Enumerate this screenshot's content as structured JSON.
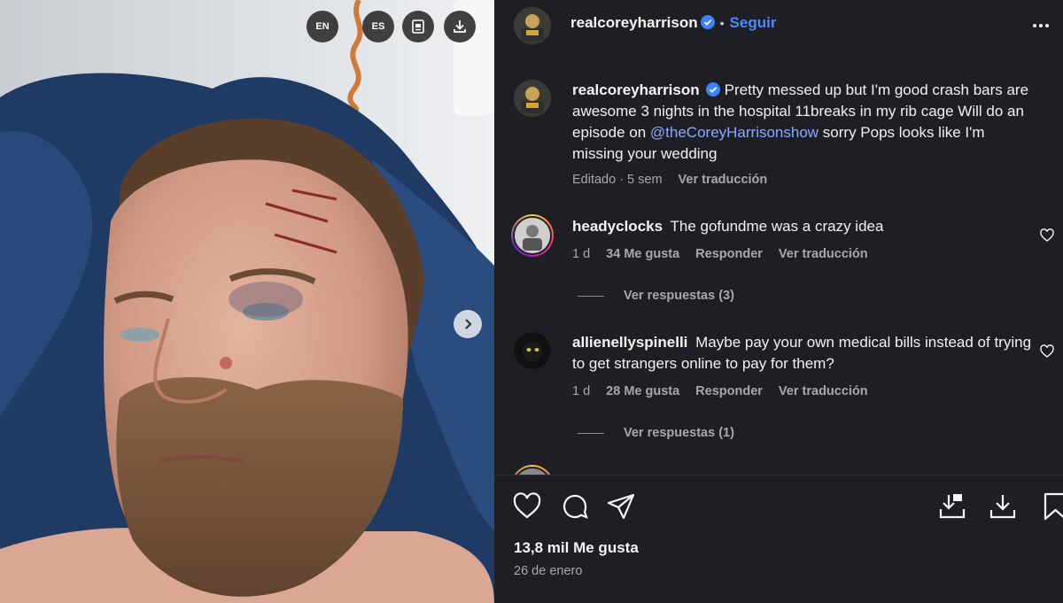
{
  "media": {
    "buttons": [
      {
        "label": "EN",
        "icon": null
      },
      {
        "label": "ES",
        "icon": null
      },
      {
        "label": "",
        "icon": "translate-doc-icon"
      },
      {
        "label": "",
        "icon": "download-icon"
      }
    ],
    "next_icon": "chevron-right-icon"
  },
  "header": {
    "username": "realcoreyharrison",
    "separator": "•",
    "follow_label": "Seguir"
  },
  "caption": {
    "username": "realcoreyharrison",
    "text_before_mention": "Pretty messed up but I'm good crash bars are awesome 3 nights in the hospital 11breaks in my rib cage Will do an episode on ",
    "mention": "@theCoreyHarrisonshow",
    "text_after_mention": " sorry Pops looks like I'm missing your wedding",
    "edited": "Editado",
    "time": "5 sem",
    "translate": "Ver traducción"
  },
  "comments": [
    {
      "username": "headyclocks",
      "text": "The gofundme was a crazy idea",
      "time": "1 d",
      "likes": "34 Me gusta",
      "reply": "Responder",
      "translate": "Ver traducción",
      "view_replies": "Ver respuestas (3)"
    },
    {
      "username": "allienellyspinelli",
      "text": "Maybe pay your own medical bills instead of trying to get strangers online to pay for them?",
      "time": "1 d",
      "likes": "28 Me gusta",
      "reply": "Responder",
      "translate": "Ver traducción",
      "view_replies": "Ver respuestas (1)"
    }
  ],
  "footer": {
    "likes": "13,8 mil Me gusta",
    "date": "26 de enero"
  },
  "colors": {
    "panel_bg": "#1e1f24",
    "follow": "#4f88ff",
    "mention": "#8aa9ff",
    "verified": "#3b82f6"
  }
}
